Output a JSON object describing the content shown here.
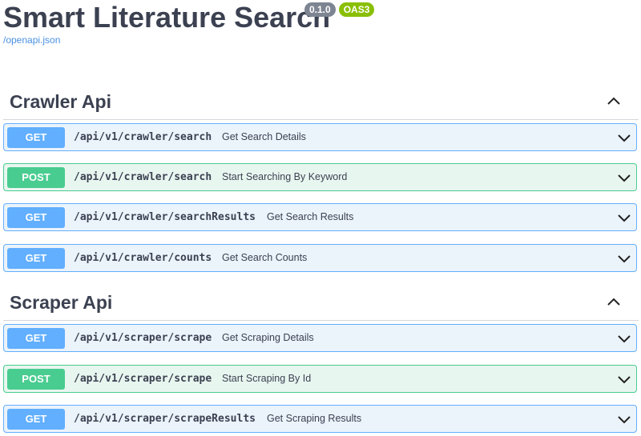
{
  "header": {
    "title": "Smart Literature Search",
    "version_badge": "0.1.0",
    "oas_badge": "OAS3",
    "spec_link": "/openapi.json"
  },
  "tags": [
    {
      "name": "Crawler Api",
      "operations": [
        {
          "method": "GET",
          "path": "/api/v1/crawler/search",
          "summary": "Get Search Details"
        },
        {
          "method": "POST",
          "path": "/api/v1/crawler/search",
          "summary": "Start Searching By Keyword"
        },
        {
          "method": "GET",
          "path": "/api/v1/crawler/searchResults",
          "summary": "Get Search Results"
        },
        {
          "method": "GET",
          "path": "/api/v1/crawler/counts",
          "summary": "Get Search Counts"
        }
      ]
    },
    {
      "name": "Scraper Api",
      "operations": [
        {
          "method": "GET",
          "path": "/api/v1/scraper/scrape",
          "summary": "Get Scraping Details"
        },
        {
          "method": "POST",
          "path": "/api/v1/scraper/scrape",
          "summary": "Start Scraping By Id"
        },
        {
          "method": "GET",
          "path": "/api/v1/scraper/scrapeResults",
          "summary": "Get Scraping Results"
        }
      ]
    }
  ],
  "colors": {
    "get": "#61affe",
    "post": "#49cc90",
    "title": "#3b4151",
    "link": "#4990e2"
  },
  "icons": {
    "tag_toggle": "chevron-up-icon",
    "op_toggle": "chevron-down-icon"
  }
}
